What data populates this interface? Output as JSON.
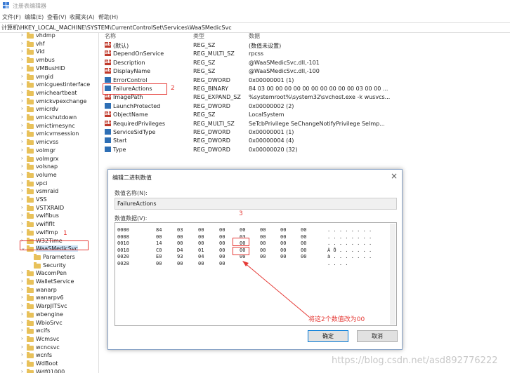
{
  "window": {
    "title": "注册表编辑器"
  },
  "menu": [
    "文件(F)",
    "编辑(E)",
    "查看(V)",
    "收藏夹(A)",
    "帮助(H)"
  ],
  "address": "计算机\\HKEY_LOCAL_MACHINE\\SYSTEM\\CurrentControlSet\\Services\\WaaSMedicSvc",
  "tree": {
    "items": [
      {
        "label": "vhdmp"
      },
      {
        "label": "vhf"
      },
      {
        "label": "Vid"
      },
      {
        "label": "vmbus"
      },
      {
        "label": "VMBusHID"
      },
      {
        "label": "vmgid"
      },
      {
        "label": "vmicguestinterface"
      },
      {
        "label": "vmicheartbeat"
      },
      {
        "label": "vmickvpexchange"
      },
      {
        "label": "vmicrdv"
      },
      {
        "label": "vmicshutdown"
      },
      {
        "label": "vmictimesync"
      },
      {
        "label": "vmicvmsession"
      },
      {
        "label": "vmicvss"
      },
      {
        "label": "volmgr"
      },
      {
        "label": "volmgrx"
      },
      {
        "label": "volsnap"
      },
      {
        "label": "volume"
      },
      {
        "label": "vpci"
      },
      {
        "label": "vsmraid"
      },
      {
        "label": "VSS"
      },
      {
        "label": "VSTXRAID"
      },
      {
        "label": "vwifibus"
      },
      {
        "label": "vwififlt"
      },
      {
        "label": "vwifimp"
      },
      {
        "label": "W32Time"
      },
      {
        "label": "WaaSMedicSvc"
      },
      {
        "label": "Parameters"
      },
      {
        "label": "Security"
      },
      {
        "label": "WacomPen"
      },
      {
        "label": "WalletService"
      },
      {
        "label": "wanarp"
      },
      {
        "label": "wanarpv6"
      },
      {
        "label": "WarpJITSvc"
      },
      {
        "label": "wbengine"
      },
      {
        "label": "WbioSrvc"
      },
      {
        "label": "wcifs"
      },
      {
        "label": "Wcmsvc"
      },
      {
        "label": "wcncsvc"
      },
      {
        "label": "wcnfs"
      },
      {
        "label": "WdBoot"
      },
      {
        "label": "Wdf01000"
      }
    ],
    "annotation": "1"
  },
  "values": {
    "headers": {
      "name": "名称",
      "type": "类型",
      "data": "数据"
    },
    "rows": [
      {
        "icon": "ab",
        "name": "(默认)",
        "type": "REG_SZ",
        "data": "(数值未设置)"
      },
      {
        "icon": "ab",
        "name": "DependOnService",
        "type": "REG_MULTI_SZ",
        "data": "rpcss"
      },
      {
        "icon": "ab",
        "name": "Description",
        "type": "REG_SZ",
        "data": "@WaaSMedicSvc.dll,-101"
      },
      {
        "icon": "ab",
        "name": "DisplayName",
        "type": "REG_SZ",
        "data": "@WaaSMedicSvc.dll,-100"
      },
      {
        "icon": "bin",
        "name": "ErrorControl",
        "type": "REG_DWORD",
        "data": "0x00000001 (1)"
      },
      {
        "icon": "bin",
        "name": "FailureActions",
        "type": "REG_BINARY",
        "data": "84 03 00 00 00 00 00 00 00 00 00 00 03 00 00 ..."
      },
      {
        "icon": "ab",
        "name": "ImagePath",
        "type": "REG_EXPAND_SZ",
        "data": "%systemroot%\\system32\\svchost.exe -k wusvcs..."
      },
      {
        "icon": "bin",
        "name": "LaunchProtected",
        "type": "REG_DWORD",
        "data": "0x00000002 (2)"
      },
      {
        "icon": "ab",
        "name": "ObjectName",
        "type": "REG_SZ",
        "data": "LocalSystem"
      },
      {
        "icon": "ab",
        "name": "RequiredPrivileges",
        "type": "REG_MULTI_SZ",
        "data": "SeTcbPrivilege SeChangeNotifyPrivilege SeImp..."
      },
      {
        "icon": "bin",
        "name": "ServiceSidType",
        "type": "REG_DWORD",
        "data": "0x00000001 (1)"
      },
      {
        "icon": "bin",
        "name": "Start",
        "type": "REG_DWORD",
        "data": "0x00000004 (4)"
      },
      {
        "icon": "bin",
        "name": "Type",
        "type": "REG_DWORD",
        "data": "0x00000020 (32)"
      }
    ],
    "annotation": "2"
  },
  "dialog": {
    "title": "编辑二进制数值",
    "close": "×",
    "name_label": "数值名称(N):",
    "name_value": "FailureActions",
    "data_label": "数值数据(V):",
    "annotation": "3",
    "hex_rows": [
      {
        "offset": "0000",
        "bytes": [
          "84",
          "03",
          "00",
          "00",
          "00",
          "00",
          "00",
          "00"
        ],
        "ascii": ". . . . . . . ."
      },
      {
        "offset": "0008",
        "bytes": [
          "00",
          "00",
          "00",
          "00",
          "03",
          "00",
          "00",
          "00"
        ],
        "ascii": ". . . . . . . ."
      },
      {
        "offset": "0010",
        "bytes": [
          "14",
          "00",
          "00",
          "00",
          "00",
          "00",
          "00",
          "00"
        ],
        "ascii": ". . . . . . . ."
      },
      {
        "offset": "0018",
        "bytes": [
          "C0",
          "D4",
          "01",
          "00",
          "00",
          "00",
          "00",
          "00"
        ],
        "ascii": "À Ô . . . . . ."
      },
      {
        "offset": "0020",
        "bytes": [
          "E0",
          "93",
          "04",
          "00",
          "00",
          "00",
          "00",
          "00"
        ],
        "ascii": "à . . . . . . ."
      },
      {
        "offset": "0028",
        "bytes": [
          "00",
          "00",
          "00",
          "00"
        ],
        "ascii": ". . . ."
      }
    ],
    "ok": "确定",
    "cancel": "取消"
  },
  "annotation_text": "将这2个数值改为00",
  "watermark": "https://blog.csdn.net/asd892776222"
}
